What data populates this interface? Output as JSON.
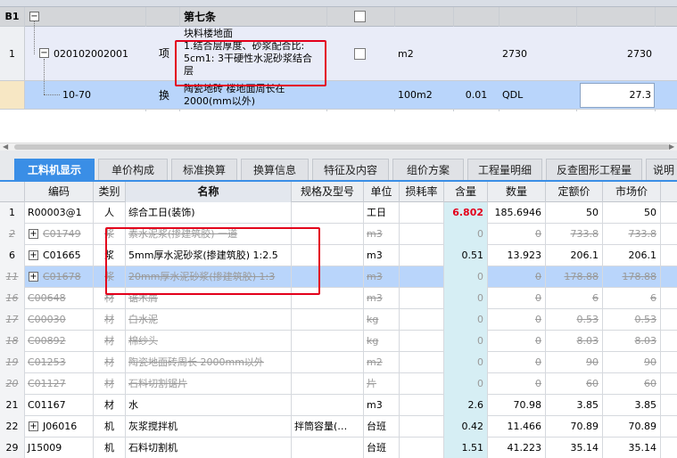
{
  "top_rows": [
    {
      "num": "B1",
      "title": "第七条"
    },
    {
      "num": "1",
      "code": "020102002001",
      "type": "项",
      "name_lines": [
        "块料楼地面",
        "1.结合层厚度、砂浆配合比:",
        "5cm1: 3干硬性水泥砂浆结合",
        "层"
      ],
      "unit": "m2",
      "qty_expr": "2730",
      "qty": "2730"
    },
    {
      "num": "",
      "code": "10-70",
      "type": "换",
      "name_lines": [
        "陶瓷地砖 楼地面周长在",
        "2000(mm以外)"
      ],
      "unit": "100m2",
      "content": "0.01",
      "qty_expr": "QDL",
      "qty": "27.3"
    }
  ],
  "tabs": [
    "工料机显示",
    "单价构成",
    "标准换算",
    "换算信息",
    "特征及内容",
    "组价方案",
    "工程量明细",
    "反查图形工程量",
    "说明"
  ],
  "columns": [
    "编码",
    "类别",
    "名称",
    "规格及型号",
    "单位",
    "损耗率",
    "含量",
    "数量",
    "定额价",
    "市场价"
  ],
  "rows": [
    {
      "num": "1",
      "code": "R00003@1",
      "type": "人",
      "name": "综合工日(装饰)",
      "spec": "",
      "unit": "工日",
      "loss": "",
      "content": "6.802",
      "qty": "185.6946",
      "price": "50",
      "market": "50",
      "expand": false,
      "struck": false
    },
    {
      "num": "2",
      "code": "C01749",
      "type": "浆",
      "name": "素水泥浆(掺建筑胶) 一道",
      "spec": "",
      "unit": "m3",
      "loss": "",
      "content": "0",
      "qty": "0",
      "price": "733.8",
      "market": "733.8",
      "expand": true,
      "struck": true
    },
    {
      "num": "6",
      "code": "C01665",
      "type": "浆",
      "name": "5mm厚水泥砂浆(掺建筑胶) 1:2.5",
      "spec": "",
      "unit": "m3",
      "loss": "",
      "content": "0.51",
      "qty": "13.923",
      "price": "206.1",
      "market": "206.1",
      "expand": true,
      "struck": false
    },
    {
      "num": "11",
      "code": "C01678",
      "type": "浆",
      "name": "20mm厚水泥砂浆(掺建筑胶) 1:3",
      "spec": "",
      "unit": "m3",
      "loss": "",
      "content": "0",
      "qty": "0",
      "price": "178.88",
      "market": "178.88",
      "expand": true,
      "struck": true,
      "selected": true
    },
    {
      "num": "16",
      "code": "C00648",
      "type": "材",
      "name": "锯木屑",
      "spec": "",
      "unit": "m3",
      "loss": "",
      "content": "0",
      "qty": "0",
      "price": "6",
      "market": "6",
      "expand": false,
      "struck": true
    },
    {
      "num": "17",
      "code": "C00030",
      "type": "材",
      "name": "白水泥",
      "spec": "",
      "unit": "kg",
      "loss": "",
      "content": "0",
      "qty": "0",
      "price": "0.53",
      "market": "0.53",
      "expand": false,
      "struck": true
    },
    {
      "num": "18",
      "code": "C00892",
      "type": "材",
      "name": "棉纱头",
      "spec": "",
      "unit": "kg",
      "loss": "",
      "content": "0",
      "qty": "0",
      "price": "8.03",
      "market": "8.03",
      "expand": false,
      "struck": true
    },
    {
      "num": "19",
      "code": "C01253",
      "type": "材",
      "name": "陶瓷地面砖周长 2000mm以外",
      "spec": "",
      "unit": "m2",
      "loss": "",
      "content": "0",
      "qty": "0",
      "price": "90",
      "market": "90",
      "expand": false,
      "struck": true
    },
    {
      "num": "20",
      "code": "C01127",
      "type": "材",
      "name": "石料切割锯片",
      "spec": "",
      "unit": "片",
      "loss": "",
      "content": "0",
      "qty": "0",
      "price": "60",
      "market": "60",
      "expand": false,
      "struck": true
    },
    {
      "num": "21",
      "code": "C01167",
      "type": "材",
      "name": "水",
      "spec": "",
      "unit": "m3",
      "loss": "",
      "content": "2.6",
      "qty": "70.98",
      "price": "3.85",
      "market": "3.85",
      "expand": false,
      "struck": false
    },
    {
      "num": "22",
      "code": "J06016",
      "type": "机",
      "name": "灰浆搅拌机",
      "spec": "拌筒容量(…",
      "unit": "台班",
      "loss": "",
      "content": "0.42",
      "qty": "11.466",
      "price": "70.89",
      "market": "70.89",
      "expand": true,
      "struck": false
    },
    {
      "num": "29",
      "code": "J15009",
      "type": "机",
      "name": "石料切割机",
      "spec": "",
      "unit": "台班",
      "loss": "",
      "content": "1.51",
      "qty": "41.223",
      "price": "35.14",
      "market": "35.14",
      "expand": false,
      "struck": false
    }
  ],
  "colors": {
    "accent": "#3a8ee6",
    "highlight": "#e3001b",
    "selected_row": "#b9d5fb"
  }
}
